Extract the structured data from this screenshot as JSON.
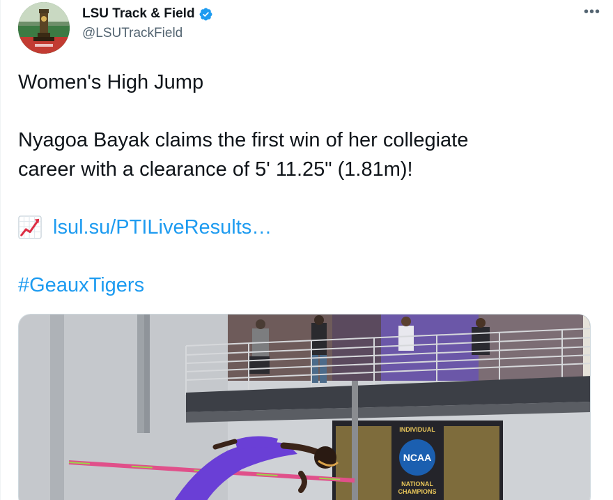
{
  "author": {
    "name": "LSU Track & Field",
    "handle": "@LSUTrackField",
    "verified": true,
    "avatar_icon": "trophy-avatar"
  },
  "menu": {
    "more_label": "•••"
  },
  "tweet": {
    "headline": "Women's High Jump",
    "body_line1": "Nyagoa Bayak claims the first win of her collegiate",
    "body_line2": "career with a clearance of 5' 11.25\" (1.81m)!",
    "link_icon": "chart-increasing-icon",
    "link_text": "lsul.su/PTILiveResults…",
    "hashtag": "#GeauxTigers"
  },
  "media": {
    "scoreboard_top": "INDIVIDUAL",
    "scoreboard_logo": "NCAA",
    "scoreboard_bottom1": "NATIONAL",
    "scoreboard_bottom2": "CHAMPIONS"
  },
  "colors": {
    "link": "#1d9bf0",
    "name": "#0f1419",
    "handle": "#536471",
    "verified": "#1d9bf0",
    "jumper_uniform": "#6a3fd6"
  }
}
